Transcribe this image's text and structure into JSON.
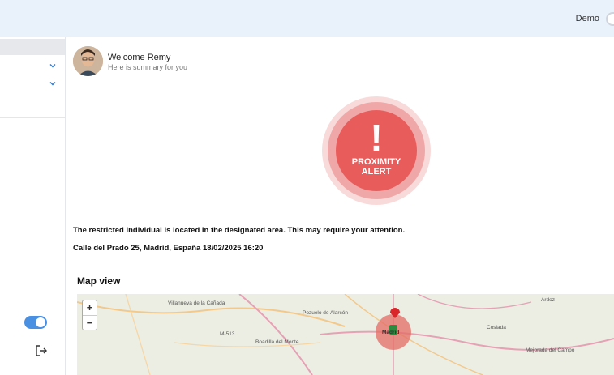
{
  "header": {
    "demo_label": "Demo"
  },
  "user": {
    "welcome": "Welcome Remy",
    "subtitle": "Here is summary for you"
  },
  "alert": {
    "line1": "PROXIMITY",
    "line2": "ALERT",
    "symbol": "!",
    "color": "#e85c5c"
  },
  "notification": {
    "message": "The restricted individual is located in the designated area. This may require your attention.",
    "location_time": "Calle del Prado 25, Madrid, España 18/02/2025 16:20"
  },
  "map": {
    "title": "Map view",
    "zoom_in": "+",
    "zoom_out": "−",
    "places": [
      "Villanueva de la Cañada",
      "Pozuelo de Alarcón",
      "Boadilla del Monte",
      "M-513",
      "Ardoz",
      "Coslada",
      "Mejorada del Campo",
      "Madrid"
    ]
  }
}
